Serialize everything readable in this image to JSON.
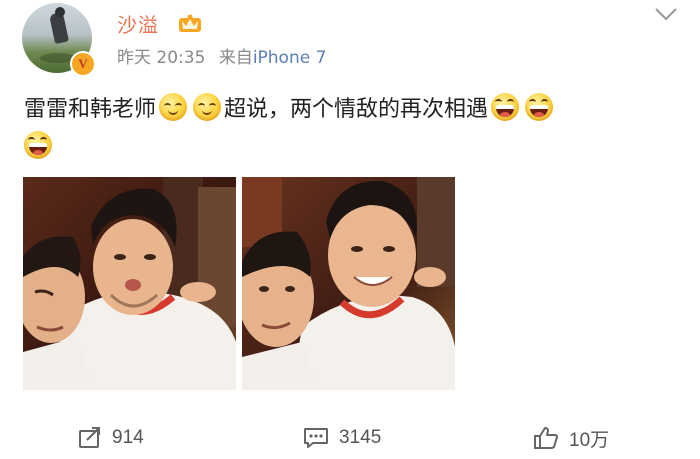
{
  "post": {
    "username": "沙溢",
    "time": "昨天 20:35",
    "source_prefix": "来自",
    "source_device": "iPhone 7",
    "text_1": "雷雷和韩老师",
    "text_2": "超说，两个情敌的再次相遇",
    "verified_mark": "V"
  },
  "actions": {
    "repost_count": "914",
    "comment_count": "3145",
    "like_count": "10万"
  },
  "colors": {
    "username": "#eb7350",
    "device_link": "#5b7fb4",
    "meta_text": "#8a8a8a",
    "verified_badge": "#f5a623"
  },
  "icons": {
    "more": "chevron-down-icon",
    "repost": "repost-icon",
    "comment": "comment-icon",
    "like": "thumbs-up-icon",
    "emoji_smile": "smile-emoji",
    "emoji_laugh": "laugh-emoji"
  }
}
